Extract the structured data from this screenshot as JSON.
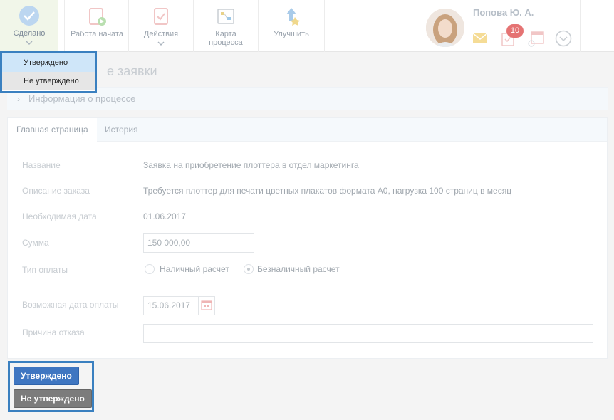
{
  "toolbar": {
    "done_label": "Сделано",
    "started_label": "Работа начата",
    "actions_label": "Действия",
    "map_label": "Карта процесса",
    "improve_label": "Улучшить"
  },
  "user": {
    "name": "Попова Ю. А.",
    "tasks_badge": "10"
  },
  "dropdown": {
    "items": [
      "Утверждено",
      "Не утверждено"
    ]
  },
  "page": {
    "title_partial": "е заявки"
  },
  "info": {
    "label": "Информация о процессе"
  },
  "tabs": [
    "Главная страница",
    "История"
  ],
  "form": {
    "name_label": "Название",
    "name_value": "Заявка на приобретение плоттера в отдел маркетинга",
    "desc_label": "Описание заказа",
    "desc_value": "Требуется плоттер для печати цветных плакатов формата А0, нагрузка 100 страниц в месяц",
    "date_label": "Необходимая дата",
    "date_value": "01.06.2017",
    "sum_label": "Сумма",
    "sum_value": "150 000,00",
    "pay_label": "Тип оплаты",
    "pay_cash": "Наличный расчет",
    "pay_noncash": "Безналичный расчет",
    "paydate_label": "Возможная дата оплаты",
    "paydate_value": "15.06.2017",
    "reason_label": "Причина отказа",
    "reason_value": ""
  },
  "buttons": {
    "approve": "Утверждено",
    "reject": "Не утверждено"
  },
  "colors": {
    "accent": "#3a80c0",
    "approve": "#3f76c1",
    "reject": "#7c7c7c",
    "badge": "#e57373"
  }
}
